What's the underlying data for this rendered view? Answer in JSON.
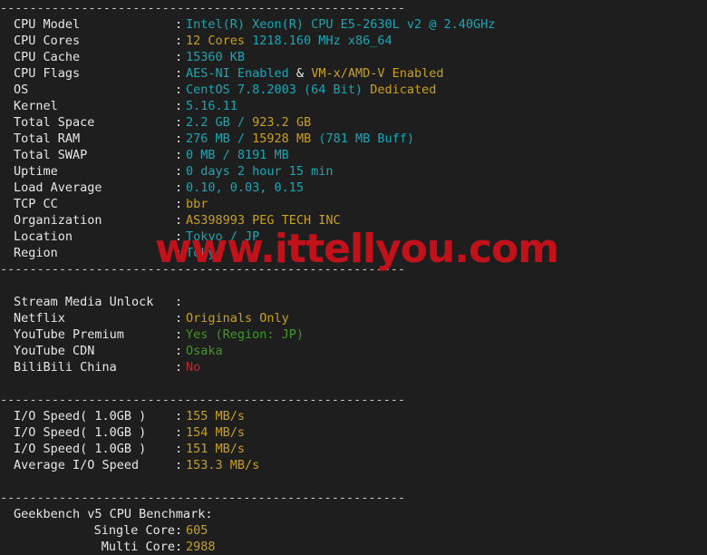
{
  "terminal": {
    "separator": "-------------------------------------------------------",
    "watermark": "www.ittellyou.com",
    "colon": ":",
    "colors": {
      "background": "#1e1e1e",
      "label": "#e6e6e6",
      "cyan": "#18a7b5",
      "orange": "#c8a020",
      "green": "#3f9a23",
      "red": "#c62828",
      "watermark": "#c1121c"
    },
    "system_info": [
      {
        "label": "CPU Model",
        "value": "Intel(R) Xeon(R) CPU E5-2630L v2 @ 2.40GHz",
        "value_color": "cyan"
      },
      {
        "label": "CPU Cores",
        "value": "12 Cores",
        "value_color": "orange",
        "value2": " 1218.160 MHz x86_64",
        "value2_color": "cyan"
      },
      {
        "label": "CPU Cache",
        "value": "15360 KB",
        "value_color": "cyan"
      },
      {
        "label": "CPU Flags",
        "value": "AES-NI Enabled",
        "value_color": "cyan",
        "value2": " & ",
        "value2_color": "white",
        "value3": "VM-x/AMD-V Enabled",
        "value3_color": "orange"
      },
      {
        "label": "OS",
        "value": "CentOS 7.8.2003 (64 Bit)",
        "value_color": "cyan",
        "value2": " ",
        "value2_color": "white",
        "value3": "Dedicated",
        "value3_color": "orange"
      },
      {
        "label": "Kernel",
        "value": "5.16.11",
        "value_color": "cyan"
      },
      {
        "label": "Total Space",
        "value": "2.2 GB",
        "value_color": "cyan",
        "value2": " / ",
        "value2_color": "cyan",
        "value3": "923.2 GB",
        "value3_color": "orange"
      },
      {
        "label": "Total RAM",
        "value": "276 MB",
        "value_color": "cyan",
        "value2": " / ",
        "value2_color": "cyan",
        "value3": "15928 MB",
        "value3_color": "orange",
        "value4": " (781 MB Buff)",
        "value4_color": "cyan"
      },
      {
        "label": "Total SWAP",
        "value": "0 MB / 8191 MB",
        "value_color": "cyan"
      },
      {
        "label": "Uptime",
        "value": "0 days 2 hour 15 min",
        "value_color": "cyan"
      },
      {
        "label": "Load Average",
        "value": "0.10, 0.03, 0.15",
        "value_color": "cyan"
      },
      {
        "label": "TCP CC",
        "value": "bbr",
        "value_color": "orange"
      },
      {
        "label": "Organization",
        "value": "AS398993 PEG TECH INC",
        "value_color": "orange"
      },
      {
        "label": "Location",
        "value": "Tokyo / JP",
        "value_color": "cyan"
      },
      {
        "label": "Region",
        "value": "Tokyo",
        "value_color": "cyan"
      }
    ],
    "stream_media": [
      {
        "label": "Stream Media Unlock",
        "value": "",
        "value_color": "white"
      },
      {
        "label": "Netflix",
        "value": "Originals Only",
        "value_color": "orange"
      },
      {
        "label": "YouTube Premium",
        "value": "Yes (Region: JP)",
        "value_color": "green"
      },
      {
        "label": "YouTube CDN",
        "value": "Osaka",
        "value_color": "green"
      },
      {
        "label": "BiliBili China",
        "value": "No",
        "value_color": "red"
      }
    ],
    "io_speed": [
      {
        "label": "I/O Speed( 1.0GB )",
        "value": "155 MB/s",
        "value_color": "orange"
      },
      {
        "label": "I/O Speed( 1.0GB )",
        "value": "154 MB/s",
        "value_color": "orange"
      },
      {
        "label": "I/O Speed( 1.0GB )",
        "value": "151 MB/s",
        "value_color": "orange"
      },
      {
        "label": "Average I/O Speed",
        "value": "153.3 MB/s",
        "value_color": "orange"
      }
    ],
    "geekbench": {
      "title": "Geekbench v5 CPU Benchmark:",
      "rows": [
        {
          "label": "Single Core",
          "value": "605",
          "value_color": "orange"
        },
        {
          "label": "Multi Core",
          "value": "2988",
          "value_color": "orange"
        }
      ]
    }
  }
}
